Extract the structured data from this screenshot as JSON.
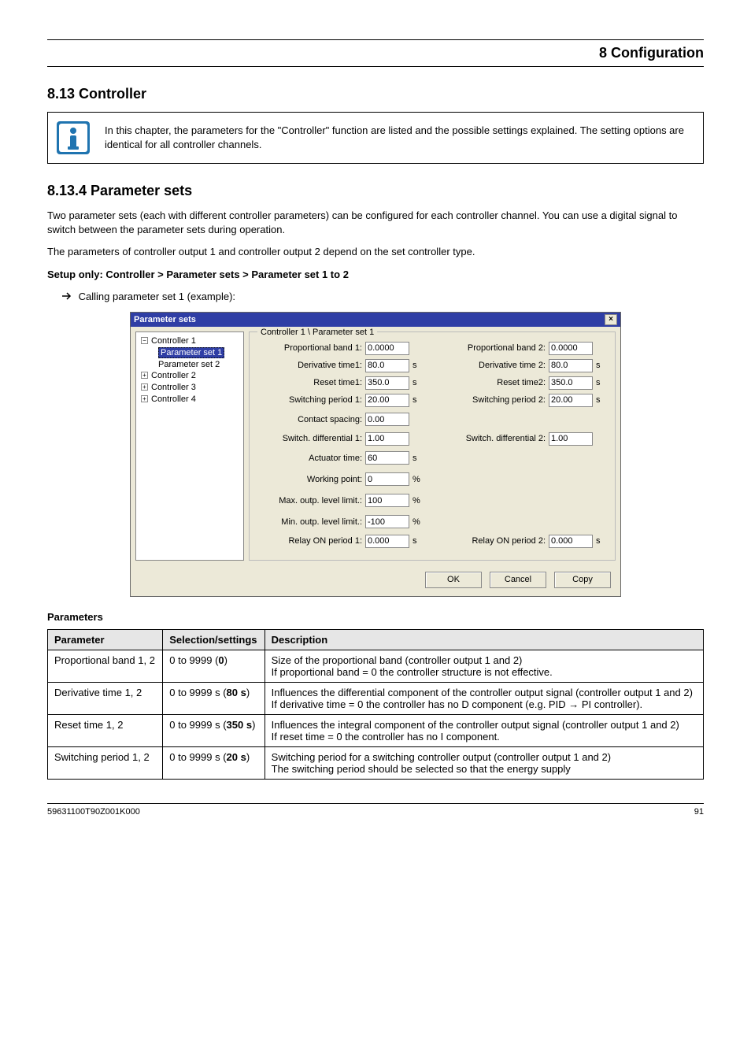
{
  "page": {
    "header_title": "8 Configuration",
    "section_num_title": "8.13 Controller",
    "subsection_title": "8.13.4 Parameter sets",
    "subsection_navpath": "Setup only: Controller > Parameter sets > Parameter set 1 to 2",
    "info_text": "In this chapter, the parameters for the \"Controller\" function are listed and the possible settings explained. The setting options are identical for all controller channels.",
    "nav_instr": "Calling parameter set 1 (example):",
    "body_para1": "Two parameter sets (each with different controller parameters) can be configured for each controller channel. You can use a digital signal to switch between the parameter sets during operation.",
    "body_para2": "The parameters of controller output 1 and controller output 2 depend on the set controller type.",
    "table_heading": "Parameters",
    "footer_left": "59631100T90Z001K000",
    "footer_right": "91"
  },
  "dialog": {
    "title": "Parameter sets",
    "tree": {
      "c1": "Controller 1",
      "p1": "Parameter set 1",
      "p2": "Parameter set 2",
      "c2": "Controller 2",
      "c3": "Controller 3",
      "c4": "Controller 4"
    },
    "fieldset_label": "Controller 1 \\ Parameter set 1",
    "rows": [
      {
        "l1": "Proportional band 1:",
        "v1": "0.0000",
        "u1": "",
        "l2": "Proportional band 2:",
        "v2": "0.0000",
        "u2": ""
      },
      {
        "l1": "Derivative time1:",
        "v1": "80.0",
        "u1": "s",
        "l2": "Derivative time 2:",
        "v2": "80.0",
        "u2": "s"
      },
      {
        "l1": "Reset time1:",
        "v1": "350.0",
        "u1": "s",
        "l2": "Reset time2:",
        "v2": "350.0",
        "u2": "s"
      },
      {
        "l1": "Switching period 1:",
        "v1": "20.00",
        "u1": "s",
        "l2": "Switching period 2:",
        "v2": "20.00",
        "u2": "s"
      },
      {
        "l1": "Contact spacing:",
        "v1": "0.00",
        "u1": "",
        "l2": "",
        "v2": "",
        "u2": ""
      },
      {
        "l1": "Switch. differential 1:",
        "v1": "1.00",
        "u1": "",
        "l2": "Switch. differential 2:",
        "v2": "1.00",
        "u2": ""
      },
      {
        "l1": "Actuator time:",
        "v1": "60",
        "u1": "s",
        "l2": "",
        "v2": "",
        "u2": ""
      },
      {
        "l1": "Working point:",
        "v1": "0",
        "u1": "%",
        "l2": "",
        "v2": "",
        "u2": ""
      },
      {
        "l1": "Max. outp. level limit.:",
        "v1": "100",
        "u1": "%",
        "l2": "",
        "v2": "",
        "u2": ""
      },
      {
        "l1": "Min. outp. level limit.:",
        "v1": "-100",
        "u1": "%",
        "l2": "",
        "v2": "",
        "u2": ""
      },
      {
        "l1": "Relay ON period 1:",
        "v1": "0.000",
        "u1": "s",
        "l2": "Relay ON period 2:",
        "v2": "0.000",
        "u2": "s"
      }
    ],
    "buttons": {
      "ok": "OK",
      "cancel": "Cancel",
      "copy": "Copy"
    }
  },
  "table": {
    "h1": "Parameter",
    "h2": "Selection/settings",
    "h3": "Description",
    "rows": [
      {
        "p": "Proportional band 1, 2",
        "s": "0 to 9999 (0)",
        "d": "Size of the proportional band (controller output 1 and 2)\nIf proportional band = 0 the controller structure is not effective."
      },
      {
        "p": "Derivative time 1, 2",
        "s": "0 to 9999 s (80 s)",
        "d": "Influences the differential component of the controller output signal (controller output 1 and 2)\nIf derivative time = 0 the controller has no D component (e.g. PID > PI controller)."
      },
      {
        "p": "Reset time 1, 2",
        "s": "0 to 9999 s (350 s)",
        "d": "Influences the integral component of the controller output signal (controller output 1 and 2)\nIf reset time = 0 the controller has no I component."
      },
      {
        "p": "Switching period 1, 2",
        "s": "0 to 9999 s (20 s)",
        "d": "Switching period for a switching controller output (controller output 1 and 2)\nThe switching period should be selected so that the energy supply"
      }
    ]
  }
}
